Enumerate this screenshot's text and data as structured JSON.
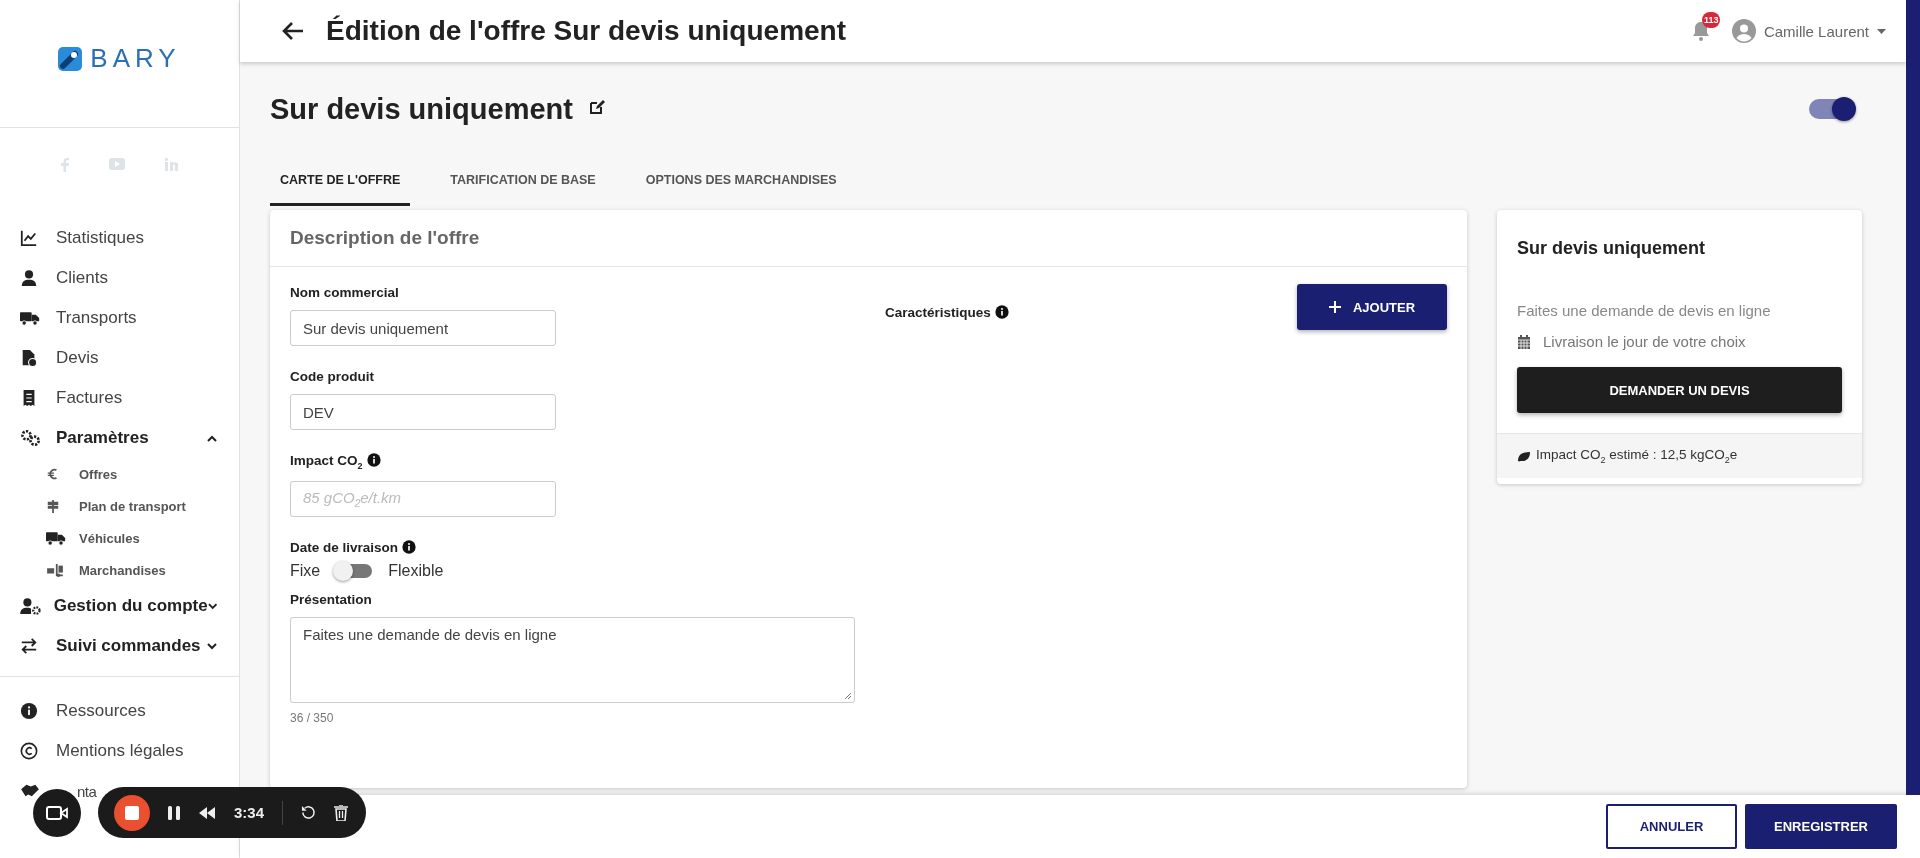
{
  "logo": {
    "text": "BARY"
  },
  "sidebar": {
    "items": [
      {
        "label": "Statistiques",
        "kind": "main"
      },
      {
        "label": "Clients",
        "kind": "main"
      },
      {
        "label": "Transports",
        "kind": "main"
      },
      {
        "label": "Devis",
        "kind": "main"
      },
      {
        "label": "Factures",
        "kind": "main"
      },
      {
        "label": "Paramètres",
        "kind": "group",
        "expanded": true,
        "children": [
          {
            "label": "Offres"
          },
          {
            "label": "Plan de transport"
          },
          {
            "label": "Véhicules"
          },
          {
            "label": "Marchandises"
          }
        ]
      },
      {
        "label": "Gestion du compte",
        "kind": "group",
        "expanded": false
      },
      {
        "label": "Suivi commandes",
        "kind": "group",
        "expanded": false
      }
    ],
    "bottom_items": [
      {
        "label": "Ressources",
        "kind": "main"
      },
      {
        "label": "Mentions légales",
        "kind": "main"
      },
      {
        "label": "nta",
        "kind": "covered"
      }
    ]
  },
  "header": {
    "title": "Édition de l'offre Sur devis uniquement",
    "notifications": "113",
    "user": "Camille Laurent"
  },
  "offer": {
    "name": "Sur devis uniquement",
    "active": true
  },
  "tabs": [
    {
      "label": "CARTE DE L'OFFRE",
      "selected": true
    },
    {
      "label": "TARIFICATION DE BASE",
      "selected": false
    },
    {
      "label": "OPTIONS DES MARCHANDISES",
      "selected": false
    }
  ],
  "description": {
    "title": "Description de l'offre",
    "fields": [
      {
        "label": "Nom commercial",
        "info": false,
        "value": "Sur devis uniquement"
      },
      {
        "label": "Code produit",
        "info": false,
        "value": "DEV"
      },
      {
        "label": "Impact CO$_{2}$",
        "info": true,
        "placeholder": "85 gCO$_{2}$e/t.km"
      }
    ],
    "delivery_date": {
      "label": "Date de livraison",
      "info": true,
      "left": "Fixe",
      "right": "Flexible",
      "flexible": false
    },
    "presentation": {
      "label": "Présentation",
      "value": "Faites une demande de devis en ligne",
      "counter": "36 / 350"
    },
    "characteristics": {
      "label": "Caractéristiques",
      "info": true,
      "add_button": "AJOUTER"
    }
  },
  "preview": {
    "title": "Sur devis uniquement",
    "text": "Faites une demande de devis en ligne",
    "delivery": "Livraison le jour de votre choix",
    "button": "DEMANDER UN DEVIS",
    "impact": "Impact CO$_{2}$ estimé : 12,5 kgCO$_{2}$e"
  },
  "footer": {
    "cancel": "ANNULER",
    "save": "ENREGISTRER"
  },
  "recorder": {
    "time": "3:34"
  }
}
